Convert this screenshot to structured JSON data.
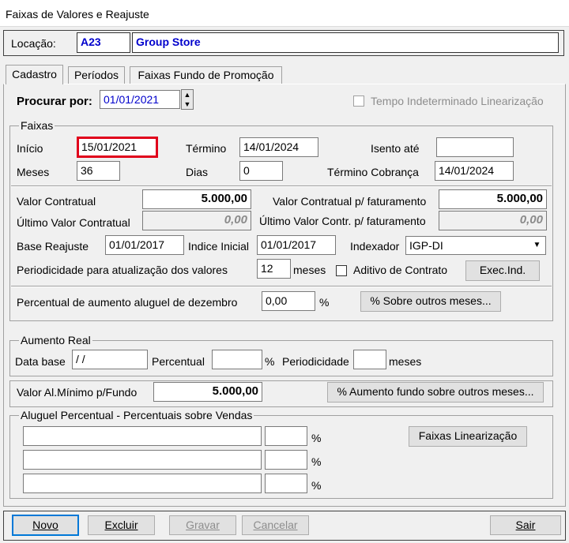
{
  "window": {
    "title": "Faixas de Valores e Reajuste"
  },
  "location": {
    "label": "Locação:",
    "code": "A23",
    "name": "Group Store"
  },
  "tabs": [
    {
      "label": "Cadastro",
      "active": true
    },
    {
      "label": "Períodos",
      "active": false
    },
    {
      "label": "Faixas Fundo de Promoção",
      "active": false
    }
  ],
  "search": {
    "label": "Procurar por:",
    "value": "01/01/2021"
  },
  "tempo_indeterminado": {
    "label": "Tempo Indeterminado Linearização",
    "checked": false
  },
  "faixas": {
    "title": "Faixas",
    "inicio_label": "Início",
    "inicio_value": "15/01/2021",
    "termino_label": "Término",
    "termino_value": "14/01/2024",
    "isento_label": "Isento até",
    "isento_value": "",
    "meses_label": "Meses",
    "meses_value": "36",
    "dias_label": "Dias",
    "dias_value": "0",
    "termino_cobranca_label": "Término Cobrança",
    "termino_cobranca_value": "14/01/2024",
    "valor_contratual_label": "Valor Contratual",
    "valor_contratual_value": "5.000,00",
    "valor_contratual_fat_label": "Valor Contratual p/ faturamento",
    "valor_contratual_fat_value": "5.000,00",
    "ultimo_valor_label": "Último Valor Contratual",
    "ultimo_valor_value": "0,00",
    "ultimo_valor_fat_label": "Último Valor Contr. p/ faturamento",
    "ultimo_valor_fat_value": "0,00",
    "base_reajuste_label": "Base Reajuste",
    "base_reajuste_value": "01/01/2017",
    "indice_inicial_label": "Indice Inicial",
    "indice_inicial_value": "01/01/2017",
    "indexador_label": "Indexador",
    "indexador_value": "IGP-DI",
    "periodicidade_label": "Periodicidade para atualização dos valores",
    "periodicidade_value": "12",
    "periodicidade_unit": "meses",
    "aditivo_label": "Aditivo de Contrato",
    "aditivo_checked": false,
    "exec_ind_label": "Exec.Ind.",
    "percentual_dez_label": "Percentual de aumento aluguel de dezembro",
    "percentual_dez_value": "0,00",
    "percent_sign": "%",
    "sobre_outros_label": "% Sobre outros meses..."
  },
  "aumento_real": {
    "title": "Aumento Real",
    "data_base_label": "Data base",
    "data_base_value": " / /",
    "percentual_label": "Percentual",
    "percentual_value": "",
    "percent_sign": "%",
    "periodicidade_label": "Periodicidade",
    "periodicidade_value": "",
    "meses_label": "meses"
  },
  "fundo": {
    "valor_minimo_label": "Valor Al.Mínimo p/Fundo",
    "valor_minimo_value": "5.000,00",
    "aumento_fundo_label": "% Aumento fundo sobre outros meses..."
  },
  "aluguel_percentual": {
    "title": "Aluguel Percentual - Percentuais sobre Vendas",
    "rows": [
      {
        "desc": "",
        "pct": "",
        "sign": "%"
      },
      {
        "desc": "",
        "pct": "",
        "sign": "%"
      },
      {
        "desc": "",
        "pct": "",
        "sign": "%"
      }
    ],
    "faixas_linearizacao_label": "Faixas Linearização"
  },
  "toolbar": {
    "novo": "Novo",
    "excluir": "Excluir",
    "gravar": "Gravar",
    "cancelar": "Cancelar",
    "sair": "Sair"
  },
  "colors": {
    "highlight": "#e0001b",
    "location_text": "#0000cc",
    "field_border": "#7a7a7a"
  },
  "icons": {
    "spin": "spin-up-down-icon",
    "dropdown": "chevron-down-icon"
  }
}
